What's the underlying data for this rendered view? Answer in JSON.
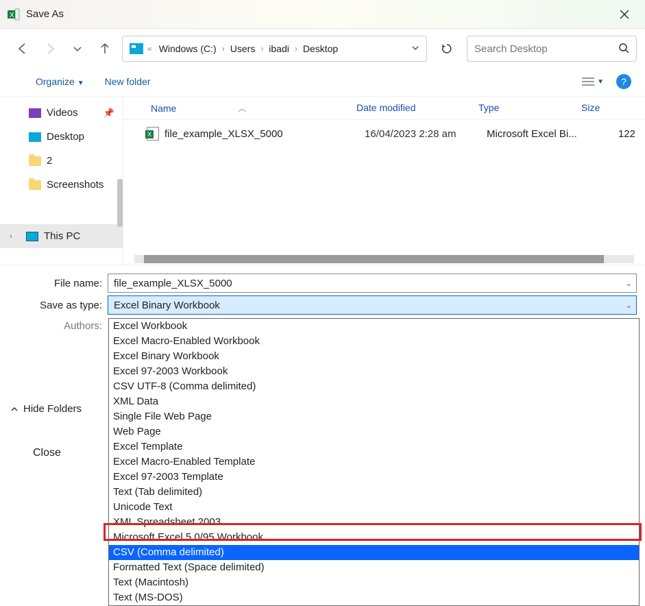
{
  "titlebar": {
    "title": "Save As"
  },
  "breadcrumb": {
    "items": [
      "Windows (C:)",
      "Users",
      "ibadi",
      "Desktop"
    ]
  },
  "search": {
    "placeholder": "Search Desktop"
  },
  "toolbar": {
    "organize": "Organize",
    "new_folder": "New folder"
  },
  "sidebar": {
    "items": [
      {
        "label": "Videos"
      },
      {
        "label": "Desktop"
      },
      {
        "label": "2"
      },
      {
        "label": "Screenshots"
      }
    ],
    "this_pc": "This PC"
  },
  "columns": {
    "name": "Name",
    "date": "Date modified",
    "type": "Type",
    "size": "Size"
  },
  "files": [
    {
      "name": "file_example_XLSX_5000",
      "date": "16/04/2023 2:28 am",
      "type": "Microsoft Excel Bi...",
      "size": "122"
    }
  ],
  "form": {
    "filename_label": "File name:",
    "filename_value": "file_example_XLSX_5000",
    "saveastype_label": "Save as type:",
    "saveastype_value": "Excel Binary Workbook",
    "authors_label": "Authors:"
  },
  "dropdown": {
    "options": [
      "Excel Workbook",
      "Excel Macro-Enabled Workbook",
      "Excel Binary Workbook",
      "Excel 97-2003 Workbook",
      "CSV UTF-8 (Comma delimited)",
      "XML Data",
      "Single File Web Page",
      "Web Page",
      "Excel Template",
      "Excel Macro-Enabled Template",
      "Excel 97-2003 Template",
      "Text (Tab delimited)",
      "Unicode Text",
      "XML Spreadsheet 2003",
      "Microsoft Excel 5.0/95 Workbook",
      "CSV (Comma delimited)",
      "Formatted Text (Space delimited)",
      "Text (Macintosh)",
      "Text (MS-DOS)"
    ],
    "selected_index": 15
  },
  "hide_folders": "Hide Folders",
  "close": "Close"
}
